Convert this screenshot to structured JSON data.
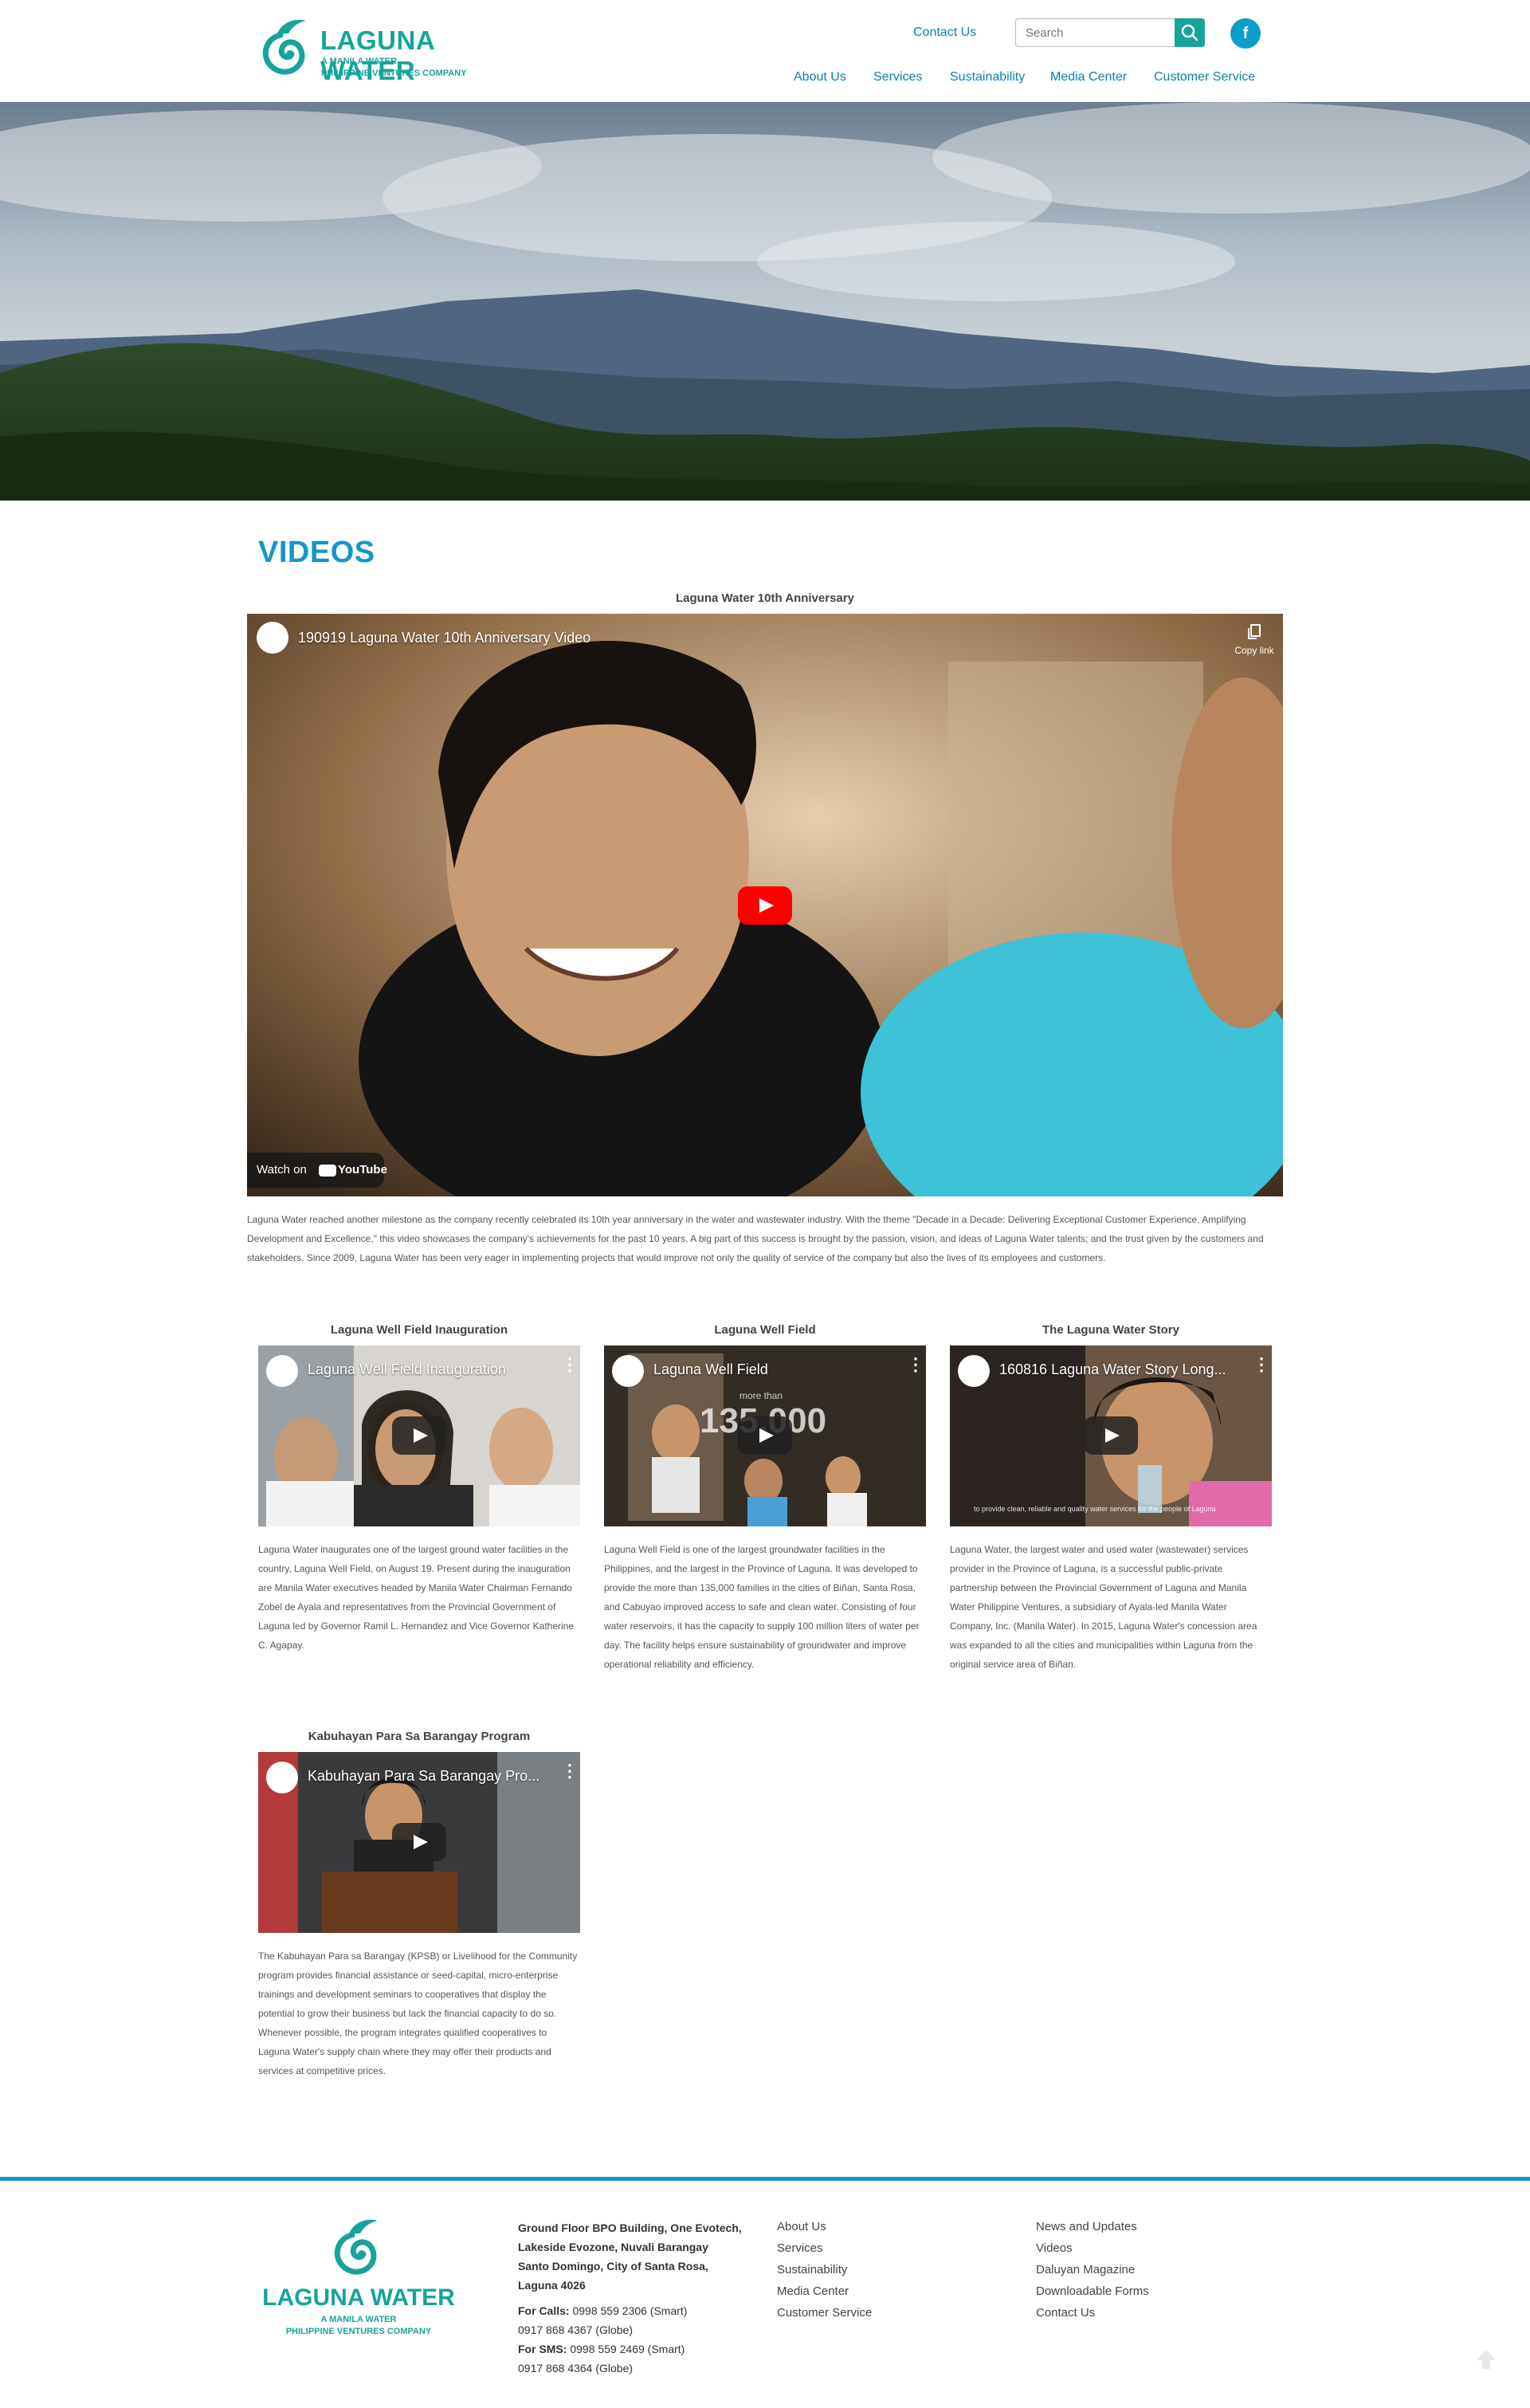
{
  "header": {
    "logo_title": "LAGUNA WATER",
    "logo_sub1": "A MANILA WATER",
    "logo_sub2": "PHILIPPINE VENTURES COMPANY",
    "contact_us": "Contact Us",
    "search_placeholder": "Search",
    "fb_label": "f",
    "nav": [
      "About Us",
      "Services",
      "Sustainability",
      "Media Center",
      "Customer Service"
    ]
  },
  "page": {
    "title": "VIDEOS"
  },
  "featured": {
    "heading": "Laguna Water 10th Anniversary",
    "player_title": "190919 Laguna Water 10th Anniversary Video",
    "copy_link": "Copy link",
    "watch_on": "Watch on",
    "youtube": "YouTube",
    "description": "Laguna Water reached another milestone as the company recently celebrated its 10th year anniversary in the water and wastewater industry. With the theme \"Decade in a Decade: Delivering Exceptional Customer Experience, Amplifying Development and Excellence,\" this video showcases the company's achievements for the past 10 years. A big part of this success is brought by the passion, vision, and ideas of Laguna Water talents; and the trust given by the customers and stakeholders. Since 2009, Laguna Water has been very eager in implementing projects that would improve not only the quality of service of the company but also the lives of its employees and customers."
  },
  "videos": [
    {
      "heading": "Laguna Well Field Inauguration",
      "player_title": "Laguna Well Field Inauguration",
      "description": "Laguna Water inaugurates one of the largest ground water facilities in the country, Laguna Well Field, on August 19. Present during the inauguration are Manila Water executives headed by Manila Water Chairman Fernando Zobel de Ayala and representatives from the Provincial Government of Laguna led by Governor Ramil L. Hernandez and Vice Governor Katherine C. Agapay."
    },
    {
      "heading": "Laguna Well Field",
      "player_title": "Laguna Well Field",
      "overlay_small": "more than",
      "overlay_big": "135,000",
      "description": "Laguna Well Field is one of the largest groundwater facilities in the Philippines, and the largest in the Province of Laguna. It was developed to provide the more than 135,000 families in the cities of Biñan, Santa Rosa, and Cabuyao improved access to safe and clean water. Consisting of four water reservoirs, it has the capacity to supply 100 million liters of water per day. The facility helps ensure sustainability of groundwater and improve operational reliability and efficiency."
    },
    {
      "heading": "The Laguna Water Story",
      "player_title": "160816 Laguna Water Story Long...",
      "caption": "to provide clean, reliable and quality water services for the people of Laguna",
      "description": "Laguna Water, the largest water and used water (wastewater) services provider in the Province of Laguna, is a successful public-private partnership between the Provincial Government of Laguna and Manila Water Philippine Ventures, a subsidiary of Ayala-led Manila Water Company, Inc. (Manila Water). In 2015, Laguna Water's concession area was expanded to all the cities and municipalities within Laguna from the original service area of Biñan."
    },
    {
      "heading": "Kabuhayan Para Sa Barangay Program",
      "player_title": "Kabuhayan Para Sa Barangay Pro...",
      "description": "The Kabuhayan Para sa Barangay (KPSB) or Livelihood for the Community program provides financial assistance or seed-capital, micro-enterprise trainings and development seminars to cooperatives that display the potential to grow their business but lack the financial capacity to do so. Whenever possible, the program integrates qualified cooperatives to Laguna Water's supply chain where they may offer their products and services at competitive prices."
    }
  ],
  "footer": {
    "logo_title": "LAGUNA WATER",
    "logo_sub1": "A MANILA WATER",
    "logo_sub2": "PHILIPPINE VENTURES COMPANY",
    "address_lines": [
      "Ground Floor BPO Building, One Evotech,",
      "Lakeside Evozone, Nuvali Barangay",
      "Santo Domingo, City of Santa Rosa,",
      "Laguna 4026"
    ],
    "calls_label": "For Calls:",
    "calls_1": "0998 559 2306 (Smart)",
    "calls_2": "0917 868 4367 (Globe)",
    "sms_label": "For SMS:",
    "sms_1": "0998 559 2469 (Smart)",
    "sms_2": "0917 868 4364 (Globe)",
    "col1": [
      "About Us",
      "Services",
      "Sustainability",
      "Media Center",
      "Customer Service"
    ],
    "col2": [
      "News and Updates",
      "Videos",
      "Daluyan Magazine",
      "Downloadable Forms",
      "Contact Us"
    ]
  },
  "colors": {
    "brand_teal": "#17a49a",
    "brand_blue": "#1596c8",
    "link_blue": "#0b82a8"
  }
}
